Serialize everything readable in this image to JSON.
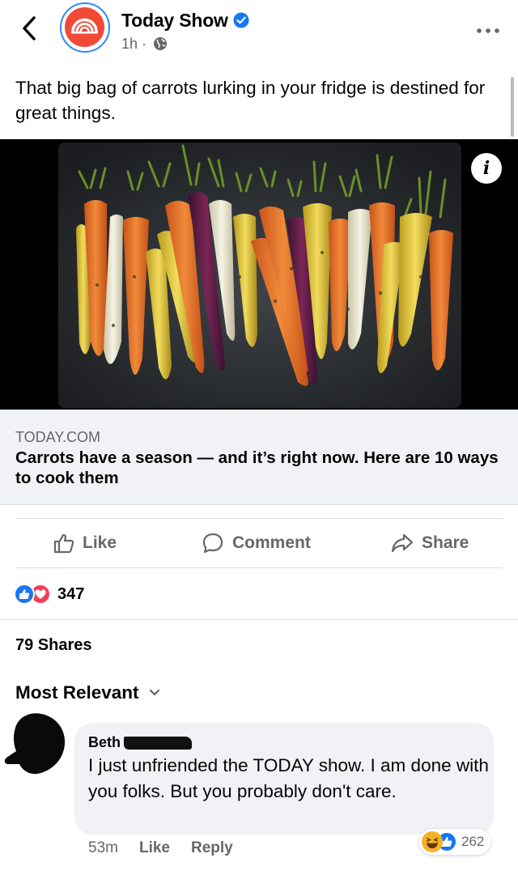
{
  "header": {
    "page_name": "Today Show",
    "time": "1h",
    "separator": "·"
  },
  "post": {
    "text": "That big bag of carrots lurking in your fridge is destined for great things."
  },
  "link": {
    "domain": "TODAY.COM",
    "title": "Carrots have a season — and it’s right now. Here are 10 ways to cook them"
  },
  "actions": {
    "like": "Like",
    "comment": "Comment",
    "share": "Share"
  },
  "stats": {
    "reaction_count": "347",
    "shares": "79 Shares"
  },
  "comments": {
    "sort_label": "Most Relevant",
    "items": [
      {
        "author": "Beth",
        "text": "I just unfriended the TODAY show. I am done with you folks. But you probably don't care.",
        "time": "53m",
        "like_label": "Like",
        "reply_label": "Reply",
        "reaction_count": "262"
      }
    ]
  },
  "colors": {
    "brand_blue": "#1877f2",
    "love_red": "#f33e58",
    "haha_yellow": "#f7b125",
    "logo_red": "#f04a37",
    "secondary_text": "#65676b"
  },
  "icons": {
    "back": "chevron-left-icon",
    "verified": "verified-badge-icon",
    "audience": "globe-icon",
    "more": "more-icon",
    "info": "info-icon",
    "like": "thumbs-up-icon",
    "comment": "comment-bubble-icon",
    "share": "share-arrow-icon",
    "sort": "chevron-down-icon"
  }
}
